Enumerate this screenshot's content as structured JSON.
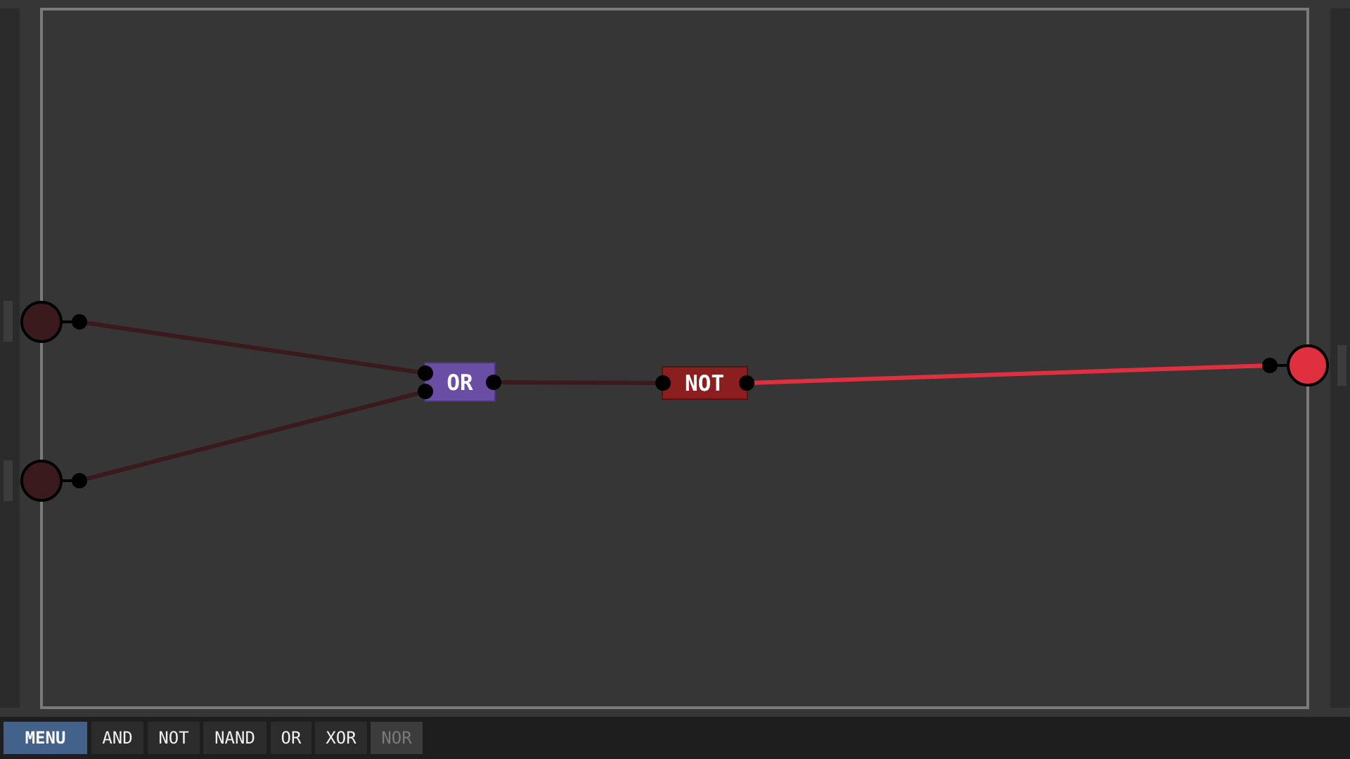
{
  "toolbar": {
    "menu_label": "MENU",
    "gates": [
      "AND",
      "NOT",
      "NAND",
      "OR",
      "XOR",
      "NOR"
    ],
    "disabled_gate": "NOR"
  },
  "circuit": {
    "inputs": [
      {
        "id": "input-1",
        "state": "off"
      },
      {
        "id": "input-2",
        "state": "off"
      }
    ],
    "gates": [
      {
        "type": "OR",
        "label": "OR",
        "color": "#6a4ea6",
        "border": "#4a3585"
      },
      {
        "type": "NOT",
        "label": "NOT",
        "color": "#8b1e1e",
        "border": "#5e1010"
      }
    ],
    "outputs": [
      {
        "id": "output-1",
        "state": "on"
      }
    ],
    "wires": [
      {
        "from": "input-1",
        "to": "OR.in1",
        "state": "off"
      },
      {
        "from": "input-2",
        "to": "OR.in2",
        "state": "off"
      },
      {
        "from": "OR.out",
        "to": "NOT.in",
        "state": "off"
      },
      {
        "from": "NOT.out",
        "to": "output-1",
        "state": "on"
      }
    ]
  },
  "colors": {
    "background": "#363636",
    "frame": "#7a7a7a",
    "side_panel": "#2b2b2b",
    "signal_off": "#3a1a1c",
    "signal_on": "#e0303f",
    "pin": "#000000",
    "menu_button": "#42628c",
    "toolbar": "#1e1e1e"
  }
}
